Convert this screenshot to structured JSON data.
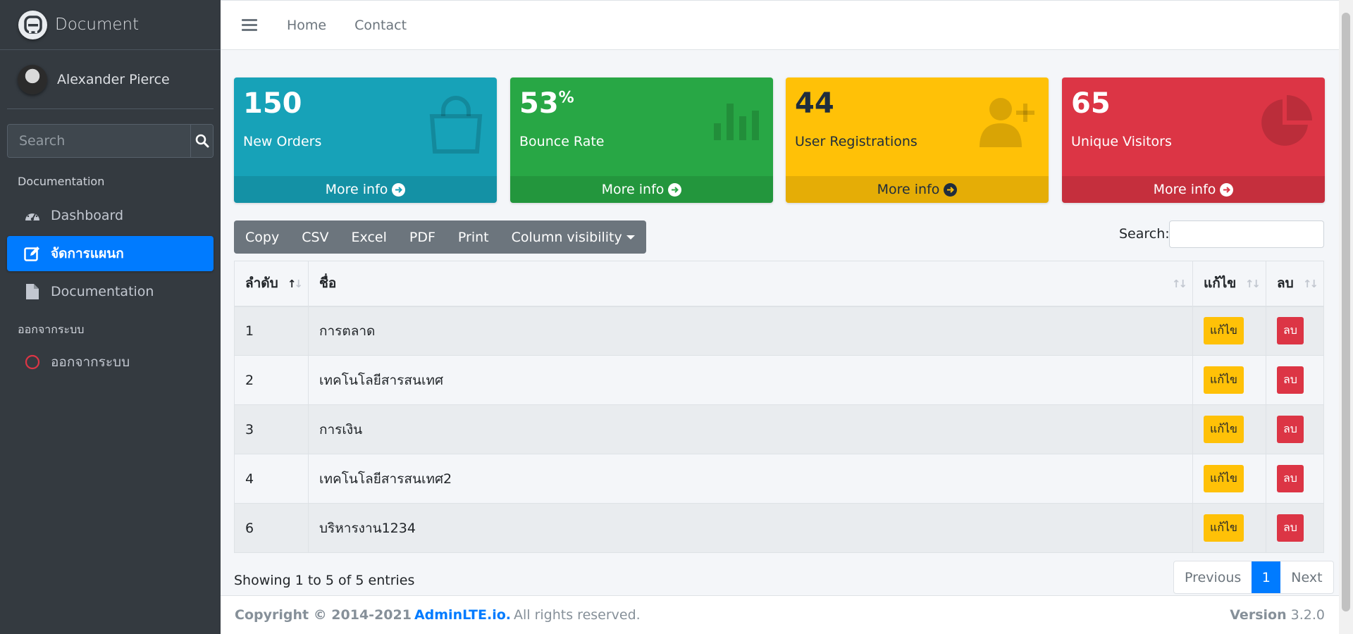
{
  "brand": {
    "name": "Document"
  },
  "user": {
    "name": "Alexander Pierce"
  },
  "sidebar": {
    "search_placeholder": "Search",
    "header1": "Documentation",
    "items": [
      {
        "label": "Dashboard",
        "icon": "dashboard-icon"
      },
      {
        "label": "จัดการแผนก",
        "icon": "edit-icon",
        "active": true
      },
      {
        "label": "Documentation",
        "icon": "file-icon"
      }
    ],
    "header2": "ออกจากระบบ",
    "logout": {
      "label": "ออกจากระบบ",
      "icon": "circle-icon"
    }
  },
  "topnav": {
    "home": "Home",
    "contact": "Contact"
  },
  "boxes": [
    {
      "value": "150",
      "label": "New Orders",
      "more": "More info",
      "color": "#17a2b8",
      "icon": "shopping-bag-icon"
    },
    {
      "value": "53",
      "suffix": "%",
      "label": "Bounce Rate",
      "more": "More info",
      "color": "#28a745",
      "icon": "bar-chart-icon"
    },
    {
      "value": "44",
      "label": "User Registrations",
      "more": "More info",
      "color": "#ffc107",
      "icon": "user-plus-icon"
    },
    {
      "value": "65",
      "label": "Unique Visitors",
      "more": "More info",
      "color": "#dc3545",
      "icon": "pie-chart-icon"
    }
  ],
  "toolbar": {
    "copy": "Copy",
    "csv": "CSV",
    "excel": "Excel",
    "pdf": "PDF",
    "print": "Print",
    "colvis": "Column visibility"
  },
  "search": {
    "label": "Search:",
    "value": ""
  },
  "table": {
    "headers": [
      "ลำดับ",
      "ชื่อ",
      "แก้ไข",
      "ลบ"
    ],
    "rows": [
      {
        "id": "1",
        "name": "การตลาด",
        "edit": "แก้ไข",
        "del": "ลบ"
      },
      {
        "id": "2",
        "name": "เทคโนโลยีสารสนเทศ",
        "edit": "แก้ไข",
        "del": "ลบ"
      },
      {
        "id": "3",
        "name": "การเงิน",
        "edit": "แก้ไข",
        "del": "ลบ"
      },
      {
        "id": "4",
        "name": "เทคโนโลยีสารสนเทศ2",
        "edit": "แก้ไข",
        "del": "ลบ"
      },
      {
        "id": "6",
        "name": "บริหารงาน1234",
        "edit": "แก้ไข",
        "del": "ลบ"
      }
    ]
  },
  "info": "Showing 1 to 5 of 5 entries",
  "pagination": {
    "previous": "Previous",
    "current": "1",
    "next": "Next"
  },
  "footer": {
    "copyright": "Copyright © 2014-2021",
    "link": "AdminLTE.io.",
    "rights": "All rights reserved.",
    "version_label": "Version",
    "version": "3.2.0"
  }
}
